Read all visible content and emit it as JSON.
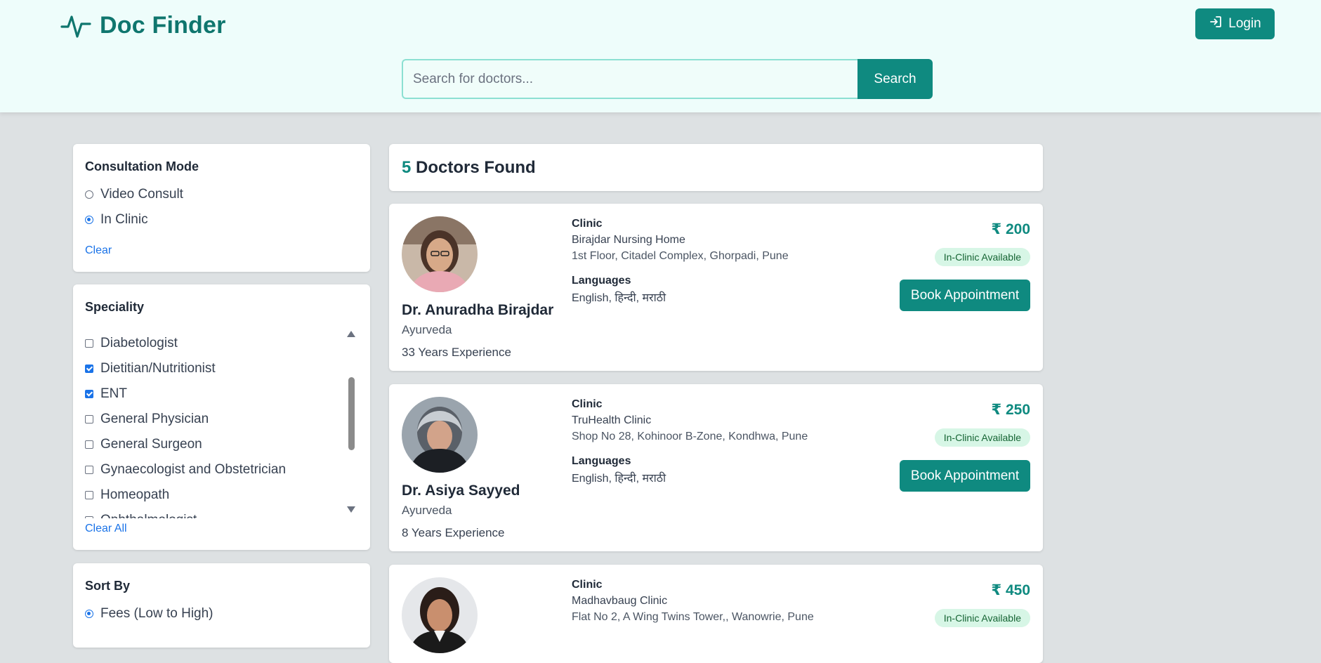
{
  "header": {
    "brand_title": "Doc Finder",
    "login_label": "Login",
    "search_placeholder": "Search for doctors...",
    "search_button_label": "Search"
  },
  "filters": {
    "consultation": {
      "title": "Consultation Mode",
      "options": [
        {
          "label": "Video Consult",
          "selected": false
        },
        {
          "label": "In Clinic",
          "selected": true
        }
      ],
      "clear_label": "Clear"
    },
    "speciality": {
      "title": "Speciality",
      "options": [
        {
          "label": "Diabetologist",
          "checked": false
        },
        {
          "label": "Dietitian/Nutritionist",
          "checked": true
        },
        {
          "label": "ENT",
          "checked": true
        },
        {
          "label": "General Physician",
          "checked": false
        },
        {
          "label": "General Surgeon",
          "checked": false
        },
        {
          "label": "Gynaecologist and Obstetrician",
          "checked": false
        },
        {
          "label": "Homeopath",
          "checked": false
        },
        {
          "label": "Ophthalmologist",
          "checked": false
        }
      ],
      "clear_all_label": "Clear All"
    },
    "sort": {
      "title": "Sort By",
      "options": [
        {
          "label": "Fees (Low to High)",
          "selected": true
        }
      ]
    }
  },
  "results": {
    "count": "5",
    "count_suffix": "Doctors Found",
    "clinic_label": "Clinic",
    "languages_label": "Languages",
    "book_label": "Book Appointment",
    "doctors": [
      {
        "name": "Dr. Anuradha Birajdar",
        "speciality": "Ayurveda",
        "experience": "33 Years Experience",
        "clinic_name": "Birajdar Nursing Home",
        "clinic_address": "1st Floor, Citadel Complex, Ghorpadi, Pune",
        "languages": "English, हिन्दी, मराठी",
        "fee": "₹ 200",
        "availability": "In-Clinic Available"
      },
      {
        "name": "Dr. Asiya Sayyed",
        "speciality": "Ayurveda",
        "experience": "8 Years Experience",
        "clinic_name": "TruHealth Clinic",
        "clinic_address": "Shop No 28, Kohinoor B-Zone, Kondhwa, Pune",
        "languages": "English, हिन्दी, मराठी",
        "fee": "₹ 250",
        "availability": "In-Clinic Available"
      },
      {
        "name": "",
        "speciality": "",
        "experience": "",
        "clinic_name": "Madhavbaug Clinic",
        "clinic_address": "Flat No 2, A Wing Twins Tower,, Wanowrie, Pune",
        "languages": "",
        "fee": "₹ 450",
        "availability": "In-Clinic Available"
      }
    ]
  },
  "colors": {
    "accent": "#0f8a80",
    "brand": "#0f766e",
    "link": "#1a73e8",
    "badge_bg": "#d7f6e6"
  },
  "icons": {
    "brand": "heartbeat-pulse-icon",
    "login": "login-arrow-icon"
  }
}
